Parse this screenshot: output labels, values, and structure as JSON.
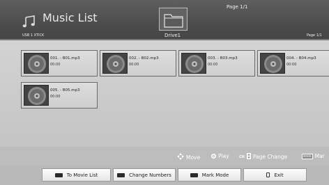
{
  "header": {
    "title": "Music List",
    "page_indicator": "Page 1/1",
    "device": "USB 1 XTICK",
    "drive": "Drive1",
    "page_small": "Page 1/1"
  },
  "files": [
    {
      "name": "001. - B01.mp3",
      "time": "00:00"
    },
    {
      "name": "002. - B02.mp3",
      "time": "00:00"
    },
    {
      "name": "003. - B03.mp3",
      "time": "00:00"
    },
    {
      "name": "004. - B04.mp3",
      "time": "00:00"
    },
    {
      "name": "005. - B05.mp3",
      "time": "00:00"
    }
  ],
  "hints": {
    "move": "Move",
    "play": "Play",
    "ch_label": "CH",
    "page_change": "Page Change",
    "mark_badge": "MARK",
    "mark": "Mar"
  },
  "buttons": {
    "to_movie_list": "To Movie List",
    "change_numbers": "Change Numbers",
    "mark_mode": "Mark Mode",
    "exit": "Exit"
  },
  "icons": {
    "title_icon": "music-note-icon",
    "folder_icon": "folder-icon",
    "thumb_icon": "disc-icon",
    "move_icon": "move-arrows-icon",
    "play_icon": "ok-button-icon",
    "exit_icon": "exit-icon"
  }
}
